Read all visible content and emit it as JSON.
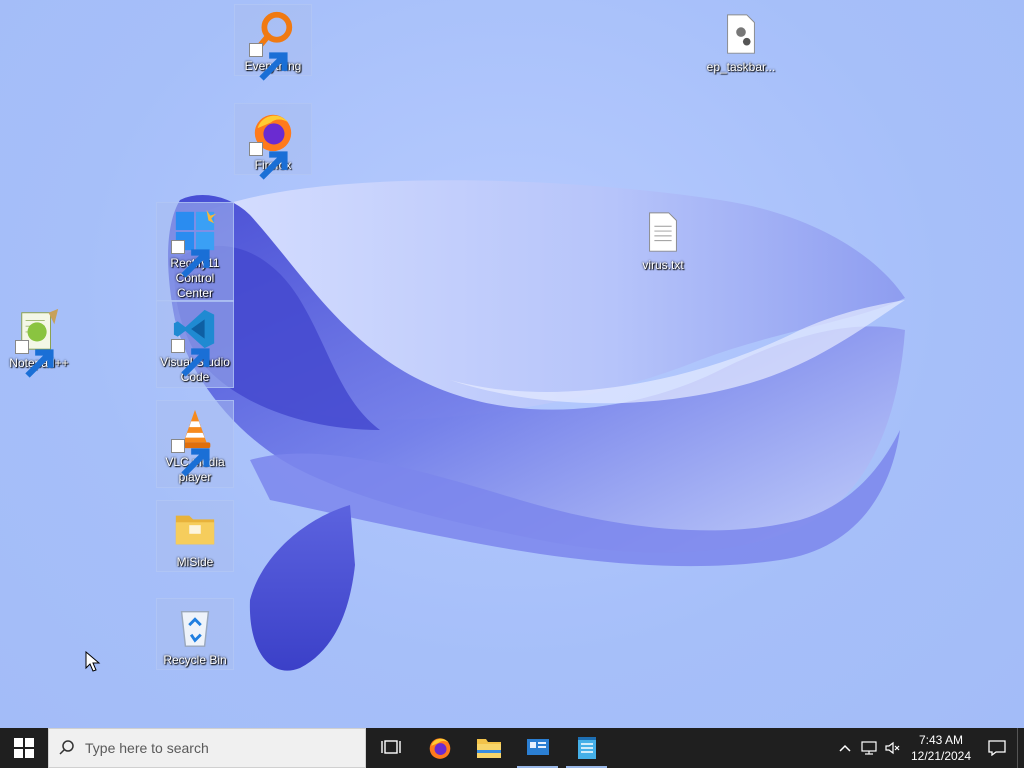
{
  "desktop": {
    "icons": [
      {
        "label": "Everything"
      },
      {
        "label": "Firefox"
      },
      {
        "label": "Rectify11 Control Center"
      },
      {
        "label": "Visual Studio Code"
      },
      {
        "label": "VLC media player"
      },
      {
        "label": "MiSide"
      },
      {
        "label": "Recycle Bin"
      },
      {
        "label": "Notepad++"
      },
      {
        "label": "ep_taskbar..."
      },
      {
        "label": "virus.txt"
      }
    ]
  },
  "taskbar": {
    "search_placeholder": "Type here to search",
    "pinned": [
      "task-view-icon",
      "firefox-icon",
      "file-explorer-icon",
      "control-panel-icon",
      "notepad-icon"
    ],
    "clock_time": "7:43 AM",
    "clock_date": "12/21/2024"
  },
  "colors": {
    "desktop_bg": "#a9c1fb",
    "taskbar_bg": "#1f1f1f",
    "wave_dark": "#4a4fd6"
  }
}
